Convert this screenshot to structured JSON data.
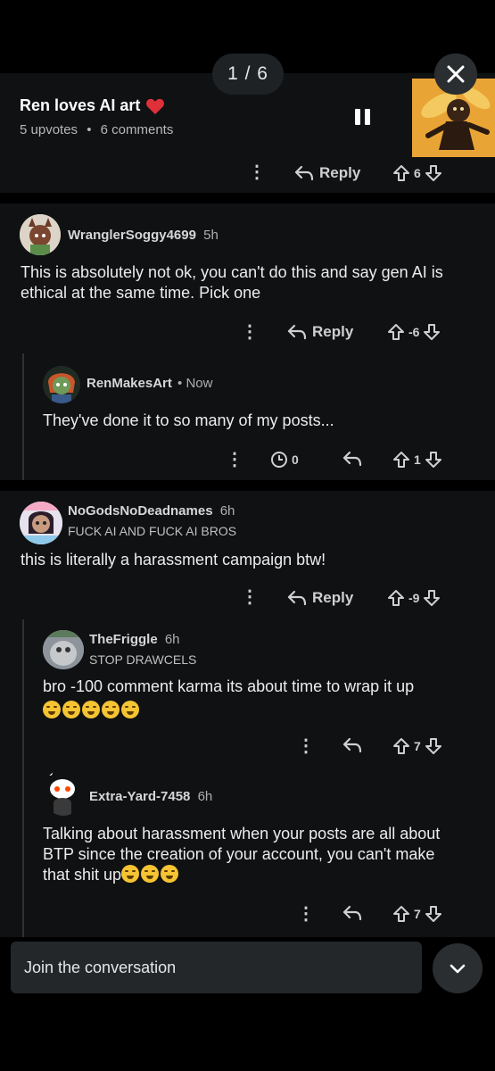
{
  "viewer": {
    "counter": "1 / 6"
  },
  "post": {
    "title": "Ren loves AI art",
    "upvotes": "5 upvotes",
    "separator": "•",
    "comments": "6 comments"
  },
  "top_actions": {
    "reply_label": "Reply",
    "score": "6"
  },
  "comments": [
    {
      "username": "WranglerSoggy4699",
      "time": "5h",
      "text": "This is absolutely not ok, you can't do this and say gen AI is ethical at the same time. Pick one",
      "reply_label": "Reply",
      "score": "-6",
      "replies": [
        {
          "username": "RenMakesArt",
          "time": "• Now",
          "text": "They've done it to so many of my posts...",
          "award_count": "0",
          "score": "1"
        }
      ]
    },
    {
      "username": "NoGodsNoDeadnames",
      "time": "6h",
      "flair": "FUCK AI AND FUCK AI BROS",
      "text": "this is literally a harassment campaign btw!",
      "reply_label": "Reply",
      "score": "-9",
      "replies": [
        {
          "username": "TheFriggle",
          "time": "6h",
          "flair": "STOP DRAWCELS",
          "text": "bro -100 comment karma its about time to wrap it up",
          "emoji_count": 5,
          "score": "7"
        },
        {
          "username": "Extra-Yard-7458",
          "time": "6h",
          "text": "Talking about harassment when your posts are all about BTP since the creation of your account, you can't make that shit up",
          "emoji_count": 3,
          "score": "7"
        }
      ]
    }
  ],
  "composer": {
    "placeholder": "Join the conversation"
  },
  "colors": {
    "background": "#000000",
    "panel": "#0f1113",
    "heart": "#e0303a",
    "text": "#e8e8e8"
  }
}
